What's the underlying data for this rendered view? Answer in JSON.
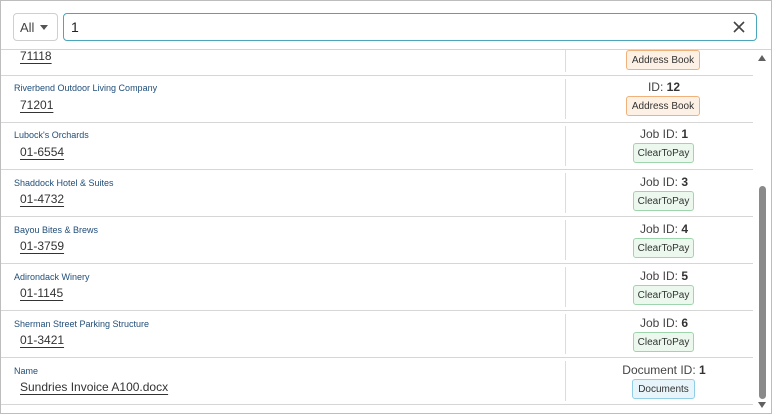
{
  "filter": {
    "selected": "All"
  },
  "search": {
    "value": "1"
  },
  "rows": [
    {
      "name": "",
      "code": "71118",
      "id_label": "",
      "id_value": "",
      "badge": "Address Book",
      "badge_type": "orange"
    },
    {
      "name": "Riverbend Outdoor Living Company",
      "code": "71201",
      "id_label": "ID:",
      "id_value": "12",
      "badge": "Address Book",
      "badge_type": "orange"
    },
    {
      "name": "Lubock's Orchards",
      "code": "01-6554",
      "id_label": "Job ID:",
      "id_value": "1",
      "badge": "ClearToPay",
      "badge_type": "green"
    },
    {
      "name": "Shaddock Hotel & Suites",
      "code": "01-4732",
      "id_label": "Job ID:",
      "id_value": "3",
      "badge": "ClearToPay",
      "badge_type": "green"
    },
    {
      "name": "Bayou Bites & Brews",
      "code": "01-3759",
      "id_label": "Job ID:",
      "id_value": "4",
      "badge": "ClearToPay",
      "badge_type": "green"
    },
    {
      "name": "Adirondack Winery",
      "code": "01-1145",
      "id_label": "Job ID:",
      "id_value": "5",
      "badge": "ClearToPay",
      "badge_type": "green"
    },
    {
      "name": "Sherman Street Parking Structure",
      "code": "01-3421",
      "id_label": "Job ID:",
      "id_value": "6",
      "badge": "ClearToPay",
      "badge_type": "green"
    },
    {
      "name": "Name",
      "code": "Sundries Invoice A100.docx",
      "id_label": "Document ID:",
      "id_value": "1",
      "badge": "Documents",
      "badge_type": "blue"
    }
  ],
  "icons": {
    "clear": "close-icon",
    "filter_caret": "caret-down-icon",
    "scroll_up": "arrow-up-icon",
    "scroll_down": "arrow-down-icon"
  },
  "colors": {
    "search_border": "#4aa6bd",
    "address_book": "#f0b27a",
    "clear_to_pay": "#9fd5ad",
    "documents": "#91cde4"
  }
}
